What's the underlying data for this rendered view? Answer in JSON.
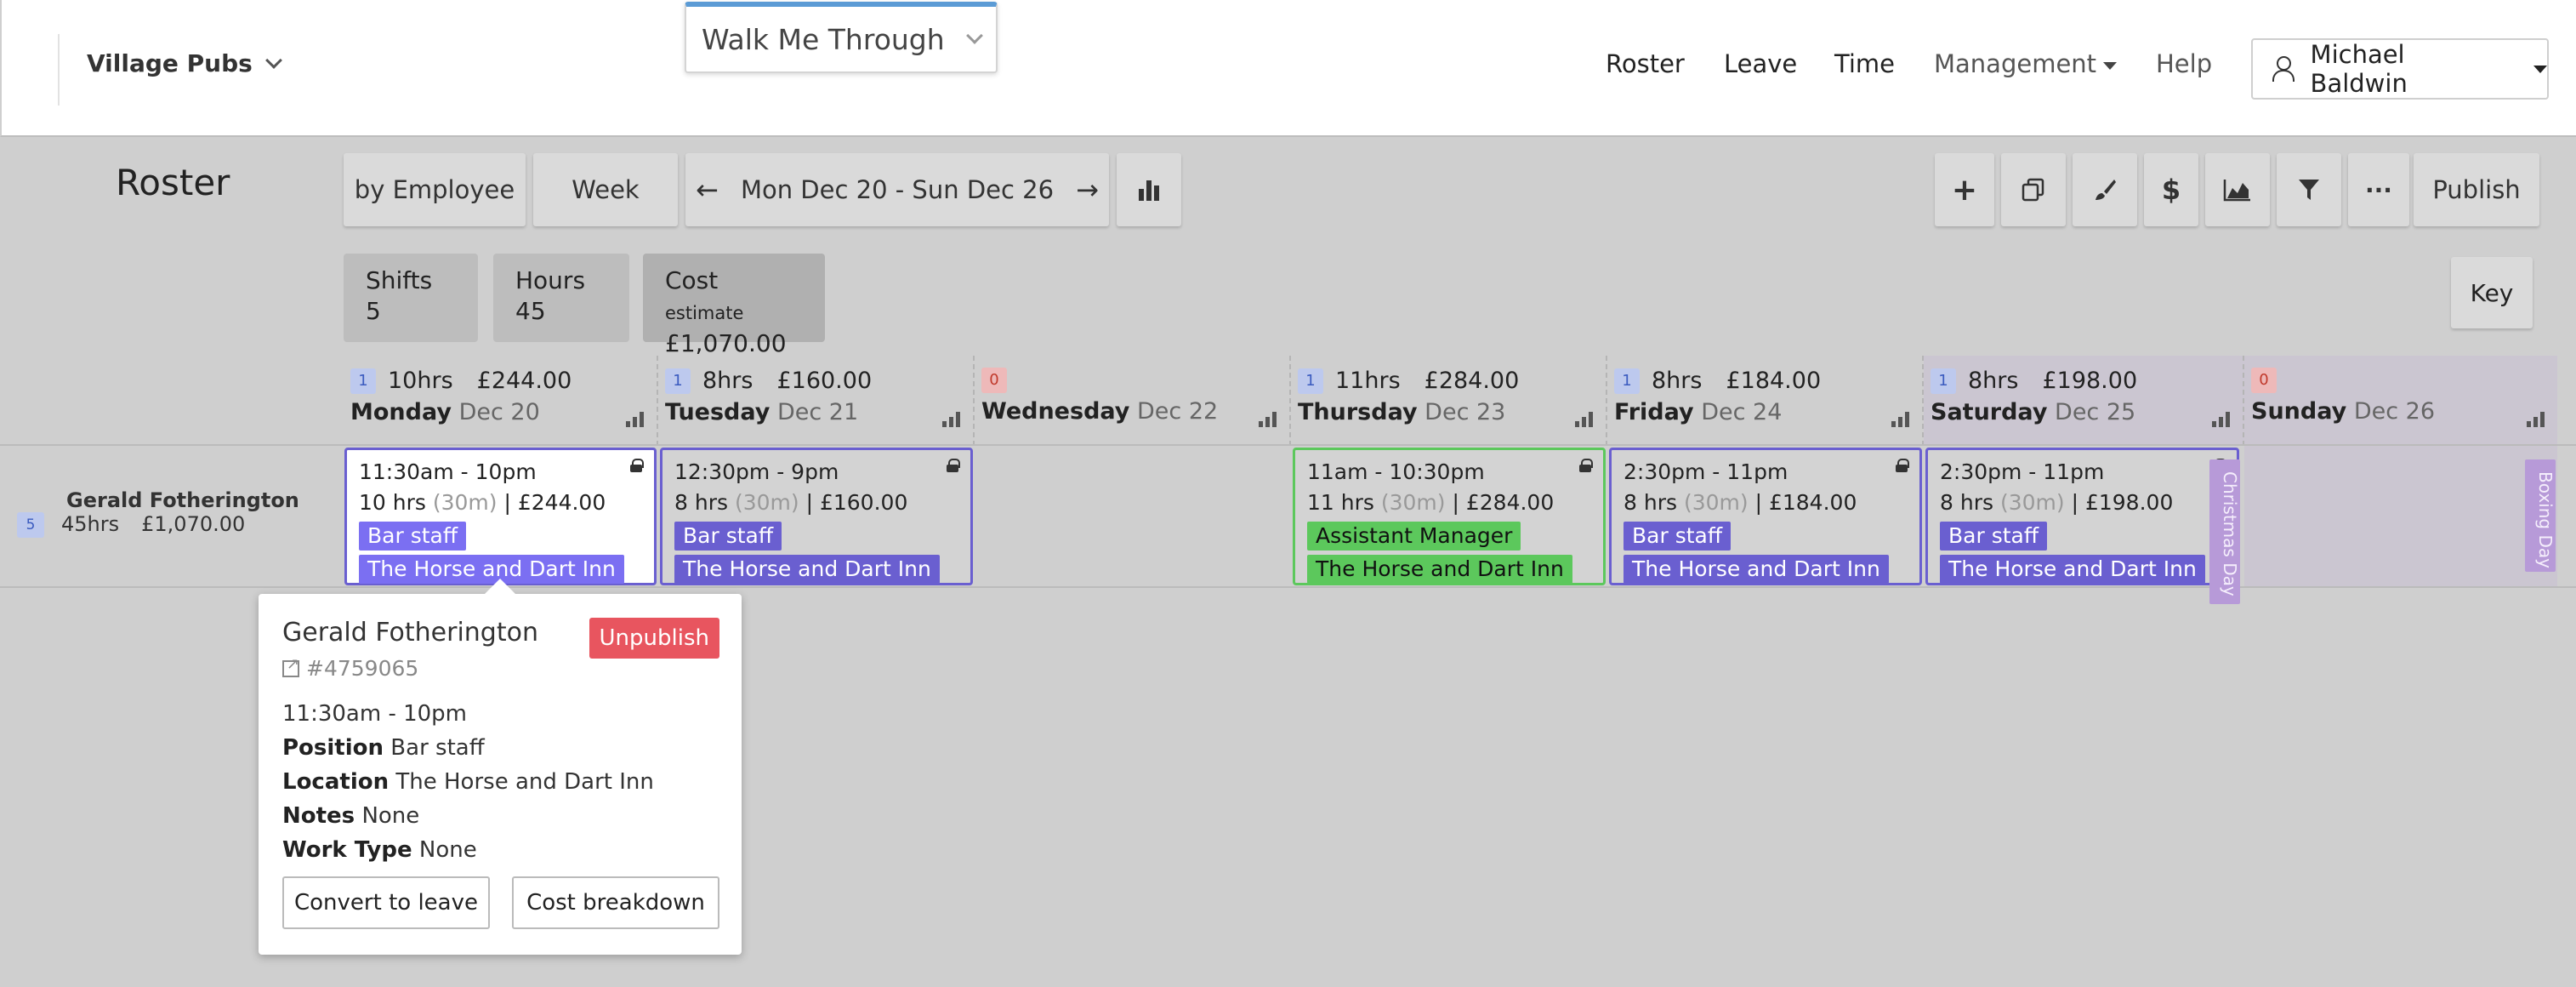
{
  "header": {
    "org_name": "Village Pubs",
    "walk_me_through": "Walk Me Through",
    "nav": {
      "roster": "Roster",
      "leave": "Leave",
      "time": "Time",
      "management": "Management",
      "help": "Help"
    },
    "user_name": "Michael Baldwin"
  },
  "toolbar": {
    "title": "Roster",
    "view_by": "by Employee",
    "period": "Week",
    "date_range": "Mon Dec 20 - Sun Dec 26",
    "prev_arrow": "←",
    "next_arrow": "→",
    "publish": "Publish",
    "icons": {
      "add": "+",
      "dollar": "$",
      "more": "···"
    }
  },
  "summary": {
    "shifts_label": "Shifts",
    "shifts_value": "5",
    "hours_label": "Hours",
    "hours_value": "45",
    "cost_label": "Cost",
    "cost_sub": "estimate",
    "cost_value": "£1,070.00",
    "key_label": "Key"
  },
  "days": [
    {
      "count": "1",
      "hours": "10hrs",
      "cost": "£244.00",
      "name": "Monday",
      "date": "Dec 20"
    },
    {
      "count": "1",
      "hours": "8hrs",
      "cost": "£160.00",
      "name": "Tuesday",
      "date": "Dec 21"
    },
    {
      "count": "0",
      "hours": "",
      "cost": "",
      "name": "Wednesday",
      "date": "Dec 22"
    },
    {
      "count": "1",
      "hours": "11hrs",
      "cost": "£284.00",
      "name": "Thursday",
      "date": "Dec 23"
    },
    {
      "count": "1",
      "hours": "8hrs",
      "cost": "£184.00",
      "name": "Friday",
      "date": "Dec 24"
    },
    {
      "count": "1",
      "hours": "8hrs",
      "cost": "£198.00",
      "name": "Saturday",
      "date": "Dec 25"
    },
    {
      "count": "0",
      "hours": "",
      "cost": "",
      "name": "Sunday",
      "date": "Dec 26"
    }
  ],
  "employee": {
    "name": "Gerald Fotherington",
    "shift_count": "5",
    "hours": "45hrs",
    "cost": "£1,070.00"
  },
  "shifts": [
    {
      "time": "11:30am - 10pm",
      "hours": "10 hrs",
      "break": "(30m)",
      "cost": "£244.00",
      "position": "Bar staff",
      "location": "The Horse and Dart Inn"
    },
    {
      "time": "12:30pm - 9pm",
      "hours": "8 hrs",
      "break": "(30m)",
      "cost": "£160.00",
      "position": "Bar staff",
      "location": "The Horse and Dart Inn"
    },
    {
      "time": "11am - 10:30pm",
      "hours": "11 hrs",
      "break": "(30m)",
      "cost": "£284.00",
      "position": "Assistant Manager",
      "location": "The Horse and Dart Inn"
    },
    {
      "time": "2:30pm - 11pm",
      "hours": "8 hrs",
      "break": "(30m)",
      "cost": "£184.00",
      "position": "Bar staff",
      "location": "The Horse and Dart Inn"
    },
    {
      "time": "2:30pm - 11pm",
      "hours": "8 hrs",
      "break": "(30m)",
      "cost": "£198.00",
      "position": "Bar staff",
      "location": "The Horse and Dart Inn"
    }
  ],
  "holidays": {
    "christmas": "Christmas Day",
    "boxing": "Boxing Day"
  },
  "popover": {
    "name": "Gerald Fotherington",
    "id": "#4759065",
    "unpublish": "Unpublish",
    "time": "11:30am - 10pm",
    "position_label": "Position",
    "position": "Bar staff",
    "location_label": "Location",
    "location": "The Horse and Dart Inn",
    "notes_label": "Notes",
    "notes": "None",
    "work_type_label": "Work Type",
    "work_type": "None",
    "convert_button": "Convert to leave",
    "cost_button": "Cost breakdown"
  },
  "colors": {
    "accent_blue": "#5b9bd5",
    "position_purple": "#6a5fd0",
    "position_green": "#5cc85c",
    "holiday": "#b79ad8",
    "unpublish_red": "#e8555f"
  }
}
